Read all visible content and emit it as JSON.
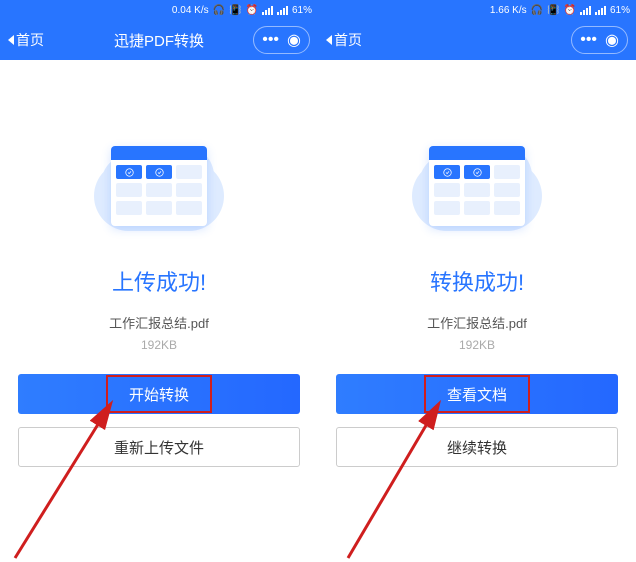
{
  "left": {
    "status_bar": {
      "speed": "0.04 K/s",
      "battery": "61%"
    },
    "nav": {
      "back_label": "首页",
      "title": "迅捷PDF转换"
    },
    "status_title": "上传成功!",
    "file_name": "工作汇报总结.pdf",
    "file_size": "192KB",
    "primary_button": "开始转换",
    "secondary_button": "重新上传文件"
  },
  "right": {
    "status_bar": {
      "speed": "1.66 K/s",
      "battery": "61%"
    },
    "nav": {
      "back_label": "首页",
      "title": ""
    },
    "status_title": "转换成功!",
    "file_name": "工作汇报总结.pdf",
    "file_size": "192KB",
    "primary_button": "查看文档",
    "secondary_button": "继续转换"
  }
}
